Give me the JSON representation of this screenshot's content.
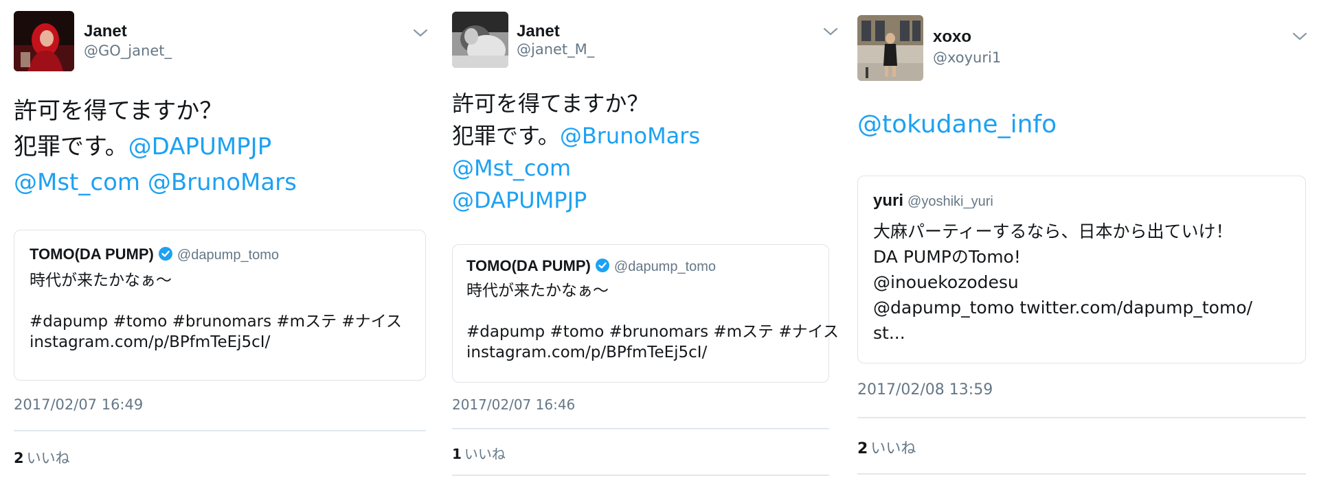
{
  "colors": {
    "mention": "#1da1f2",
    "secondary": "#657786",
    "divider": "#e1e8ed"
  },
  "tweets": [
    {
      "name": "Janet",
      "handle": "@GO_janet_",
      "body_line1": "許可を得てますか？",
      "body_line2_text": "犯罪です。",
      "mentions": [
        "@DAPUMPJP",
        "@Mst_com",
        "@BrunoMars"
      ],
      "quote": {
        "author": "TOMO(DA PUMP)",
        "handle": "@dapump_tomo",
        "verified": true,
        "lines": [
          "時代が来たかなぁ〜",
          "",
          "#dapump #tomo #brunomars #mステ #ナイス",
          "instagram.com/p/BPfmTeEj5cI/"
        ]
      },
      "timestamp": "2017/02/07 16:49",
      "like_count": "2",
      "like_label": "いいね"
    },
    {
      "name": "Janet",
      "handle": "@janet_M_",
      "body_line1": "許可を得てますか？",
      "body_line2_text": "犯罪です。",
      "mentions": [
        "@BrunoMars",
        "@Mst_com",
        "@DAPUMPJP"
      ],
      "quote": {
        "author": "TOMO(DA PUMP)",
        "handle": "@dapump_tomo",
        "verified": true,
        "lines": [
          "時代が来たかなぁ〜",
          "",
          "#dapump #tomo #brunomars #mステ #ナイス",
          "instagram.com/p/BPfmTeEj5cI/"
        ]
      },
      "timestamp": "2017/02/07 16:46",
      "like_count": "1",
      "like_label": "いいね"
    },
    {
      "name": "xoxo",
      "handle": "@xoyuri1",
      "mentions": [
        "@tokudane_info"
      ],
      "quote": {
        "author": "yuri",
        "handle": "@yoshiki_yuri",
        "verified": false,
        "lines": [
          "大麻パーティーするなら、日本から出ていけ！",
          "DA PUMPのTomo!",
          "@inouekozodesu",
          "@dapump_tomo twitter.com/dapump_tomo/",
          "st..."
        ]
      },
      "timestamp": "2017/02/08 13:59",
      "like_count": "2",
      "like_label": "いいね"
    }
  ]
}
